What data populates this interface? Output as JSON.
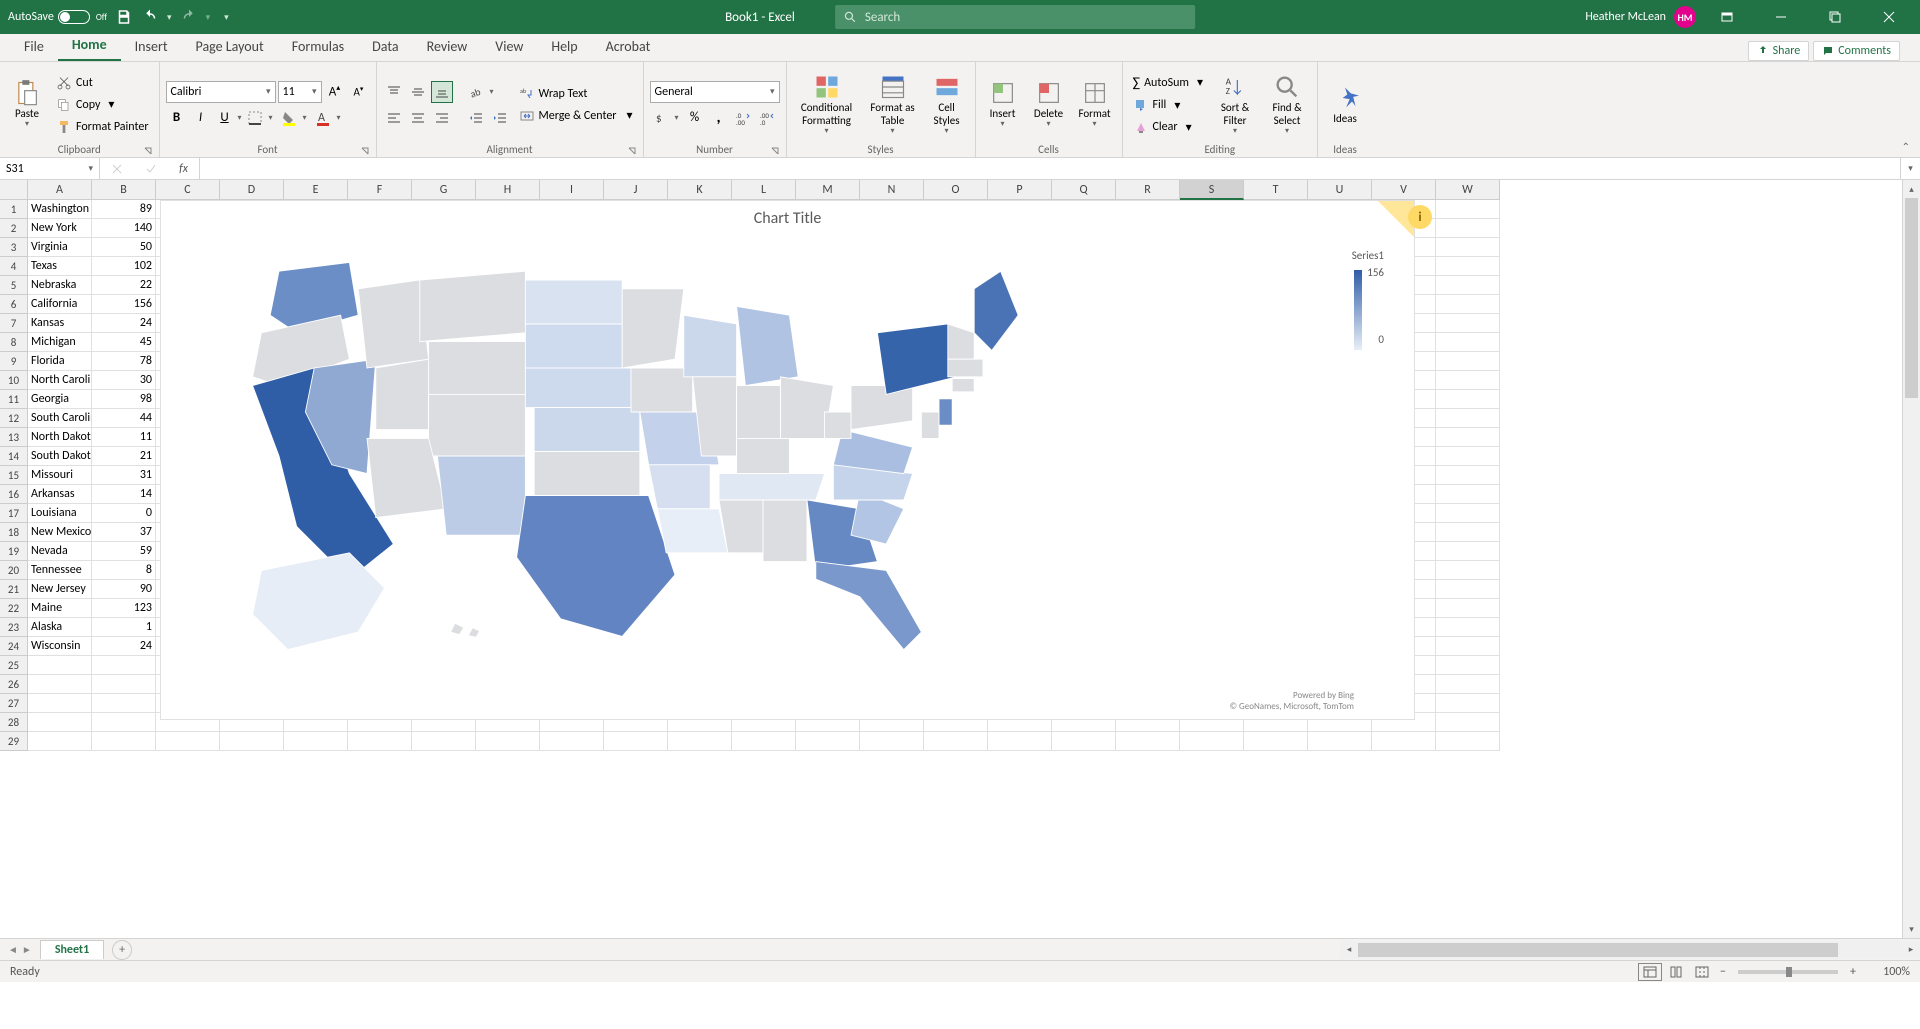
{
  "titlebar": {
    "autosave_label": "AutoSave",
    "autosave_state": "Off",
    "document": "Book1  -  Excel",
    "search_placeholder": "Search",
    "user_name": "Heather McLean",
    "user_initials": "HM"
  },
  "tabs": {
    "items": [
      "File",
      "Home",
      "Insert",
      "Page Layout",
      "Formulas",
      "Data",
      "Review",
      "View",
      "Help",
      "Acrobat"
    ],
    "active": "Home",
    "share": "Share",
    "comments": "Comments"
  },
  "ribbon": {
    "clipboard": {
      "label": "Clipboard",
      "paste": "Paste",
      "cut": "Cut",
      "copy": "Copy",
      "format_painter": "Format Painter"
    },
    "font": {
      "label": "Font",
      "name": "Calibri",
      "size": "11"
    },
    "alignment": {
      "label": "Alignment",
      "wrap": "Wrap Text",
      "merge": "Merge & Center"
    },
    "number": {
      "label": "Number",
      "format": "General"
    },
    "styles": {
      "label": "Styles",
      "conditional": "Conditional Formatting",
      "format_table": "Format as Table",
      "cell_styles": "Cell Styles"
    },
    "cells": {
      "label": "Cells",
      "insert": "Insert",
      "delete": "Delete",
      "format": "Format"
    },
    "editing": {
      "label": "Editing",
      "autosum": "AutoSum",
      "fill": "Fill",
      "clear": "Clear",
      "sort": "Sort & Filter",
      "find": "Find & Select"
    },
    "ideas": {
      "label": "Ideas",
      "ideas": "Ideas"
    }
  },
  "namebox": {
    "ref": "S31"
  },
  "columns": [
    "A",
    "B",
    "C",
    "D",
    "E",
    "F",
    "G",
    "H",
    "I",
    "J",
    "K",
    "L",
    "M",
    "N",
    "O",
    "P",
    "Q",
    "R",
    "S",
    "T",
    "U",
    "V",
    "W"
  ],
  "selected_col": "S",
  "rows": [
    {
      "state": "Washington",
      "val": 89
    },
    {
      "state": "New York",
      "val": 140
    },
    {
      "state": "Virginia",
      "val": 50
    },
    {
      "state": "Texas",
      "val": 102
    },
    {
      "state": "Nebraska",
      "val": 22
    },
    {
      "state": "California",
      "val": 156
    },
    {
      "state": "Kansas",
      "val": 24
    },
    {
      "state": "Michigan",
      "val": 45
    },
    {
      "state": "Florida",
      "val": 78
    },
    {
      "state": "North Carolina",
      "val": 30
    },
    {
      "state": "Georgia",
      "val": 98
    },
    {
      "state": "South Carolina",
      "val": 44
    },
    {
      "state": "North Dakota",
      "val": 11
    },
    {
      "state": "South Dakota",
      "val": 21
    },
    {
      "state": "Missouri",
      "val": 31
    },
    {
      "state": "Arkansas",
      "val": 14
    },
    {
      "state": "Louisiana",
      "val": 0
    },
    {
      "state": "New Mexico",
      "val": 37
    },
    {
      "state": "Nevada",
      "val": 59
    },
    {
      "state": "Tennessee",
      "val": 8
    },
    {
      "state": "New Jersey",
      "val": 90
    },
    {
      "state": "Maine",
      "val": 123
    },
    {
      "state": "Alaska",
      "val": 1
    },
    {
      "state": "Wisconsin",
      "val": 24
    }
  ],
  "chart_data": {
    "type": "map",
    "title": "Chart Title",
    "series_name": "Series1",
    "scale_max": 156,
    "scale_min": 0,
    "attribution_line1": "Powered by Bing",
    "attribution_line2": "© GeoNames, Microsoft, TomTom",
    "data": [
      {
        "region": "Washington",
        "value": 89
      },
      {
        "region": "New York",
        "value": 140
      },
      {
        "region": "Virginia",
        "value": 50
      },
      {
        "region": "Texas",
        "value": 102
      },
      {
        "region": "Nebraska",
        "value": 22
      },
      {
        "region": "California",
        "value": 156
      },
      {
        "region": "Kansas",
        "value": 24
      },
      {
        "region": "Michigan",
        "value": 45
      },
      {
        "region": "Florida",
        "value": 78
      },
      {
        "region": "North Carolina",
        "value": 30
      },
      {
        "region": "Georgia",
        "value": 98
      },
      {
        "region": "South Carolina",
        "value": 44
      },
      {
        "region": "North Dakota",
        "value": 11
      },
      {
        "region": "South Dakota",
        "value": 21
      },
      {
        "region": "Missouri",
        "value": 31
      },
      {
        "region": "Arkansas",
        "value": 14
      },
      {
        "region": "Louisiana",
        "value": 0
      },
      {
        "region": "New Mexico",
        "value": 37
      },
      {
        "region": "Nevada",
        "value": 59
      },
      {
        "region": "Tennessee",
        "value": 8
      },
      {
        "region": "New Jersey",
        "value": 90
      },
      {
        "region": "Maine",
        "value": 123
      },
      {
        "region": "Alaska",
        "value": 1
      },
      {
        "region": "Wisconsin",
        "value": 24
      }
    ]
  },
  "sheets": {
    "active": "Sheet1"
  },
  "statusbar": {
    "mode": "Ready",
    "zoom": "100%"
  }
}
